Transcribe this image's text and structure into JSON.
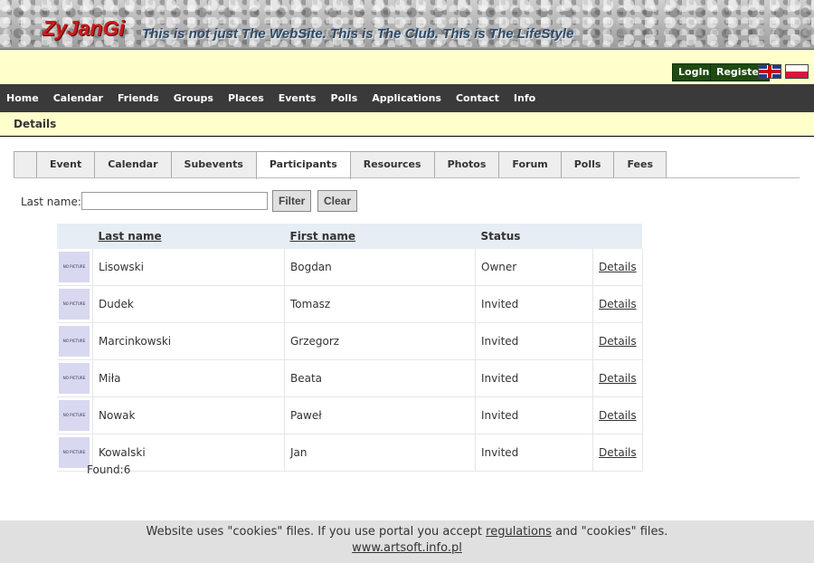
{
  "header": {
    "logo": "ZyJanGi",
    "tagline": "This is not just The WebSite. This is The Club. This is The LifeStyle",
    "login_label": "LogIn",
    "register_label": "Register"
  },
  "nav": [
    "Home",
    "Calendar",
    "Friends",
    "Groups",
    "Places",
    "Events",
    "Polls",
    "Applications",
    "Contact",
    "Info"
  ],
  "section": {
    "title": "Details"
  },
  "tabs": [
    "",
    "Event",
    "Calendar",
    "Subevents",
    "Participants",
    "Resources",
    "Photos",
    "Forum",
    "Polls",
    "Fees"
  ],
  "active_tab": "Participants",
  "filter": {
    "label": "Last name:",
    "value": "",
    "filter_button": "Filter",
    "clear_button": "Clear"
  },
  "table": {
    "columns": [
      "",
      "Last name",
      "First name",
      "Status",
      ""
    ],
    "no_picture_text": "NO PICTURE",
    "details_label": "Details",
    "rows": [
      {
        "last": "Lisowski",
        "first": "Bogdan",
        "status": "Owner"
      },
      {
        "last": "Dudek",
        "first": "Tomasz",
        "status": "Invited"
      },
      {
        "last": "Marcinkowski",
        "first": "Grzegorz",
        "status": "Invited"
      },
      {
        "last": "Miła",
        "first": "Beata",
        "status": "Invited"
      },
      {
        "last": "Nowak",
        "first": "Paweł",
        "status": "Invited"
      },
      {
        "last": "Kowalski",
        "first": "Jan",
        "status": "Invited"
      }
    ]
  },
  "found_text": "Found:6",
  "footer": {
    "text_before": "Website uses \"cookies\" files. If you use portal you accept ",
    "regulations_link": "regulations",
    "text_after": " and \"cookies\" files.",
    "site_link": "www.artsoft.info.pl"
  },
  "colors": {
    "logo": "#cc1a1a",
    "tagline": "#2f4a66",
    "auth_bar": "#ffffcc",
    "nav_bar": "#3a3a3a",
    "auth_button": "#1f4a10",
    "table_header": "#e7edf4",
    "cookie_bar": "#e0e0e0"
  }
}
